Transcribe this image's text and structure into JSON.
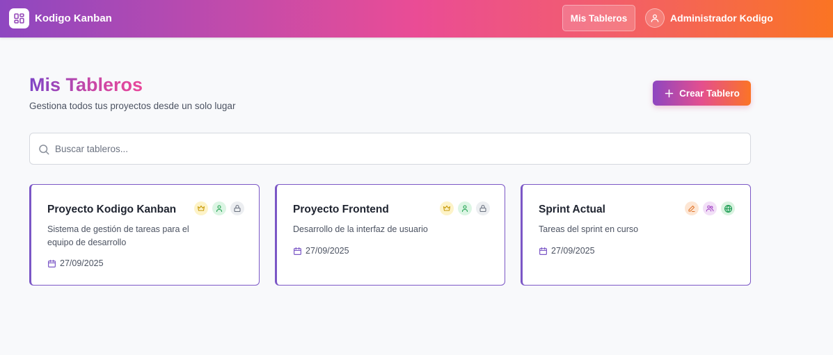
{
  "app": {
    "brand_name": "Kodigo Kanban",
    "logo_icon": "grid-icon"
  },
  "nav": {
    "boards_label": "Mis Tableros",
    "user_name": "Administrador Kodigo",
    "user_icon": "user-icon"
  },
  "header": {
    "title": "Mis Tableros",
    "subtitle": "Gestiona todos tus proyectos desde un solo lugar",
    "create_button": "Crear Tablero"
  },
  "search": {
    "placeholder": "Buscar tableros...",
    "value": ""
  },
  "colors": {
    "accent_purple": "#7b57c6",
    "gradient_start": "#8e47c0",
    "gradient_mid": "#ea4c95",
    "gradient_end": "#fa7423"
  },
  "boards": [
    {
      "title": "Proyecto Kodigo Kanban",
      "description": "Sistema de gestión de tareas para el equipo de desarrollo",
      "date": "27/09/2025",
      "badges": [
        "crown-icon",
        "user-icon",
        "lock-icon"
      ]
    },
    {
      "title": "Proyecto Frontend",
      "description": "Desarrollo de la interfaz de usuario",
      "date": "27/09/2025",
      "badges": [
        "crown-icon",
        "user-icon",
        "lock-icon"
      ]
    },
    {
      "title": "Sprint Actual",
      "description": "Tareas del sprint en curso",
      "date": "27/09/2025",
      "badges": [
        "pencil-icon",
        "users-icon",
        "globe-icon"
      ]
    }
  ]
}
